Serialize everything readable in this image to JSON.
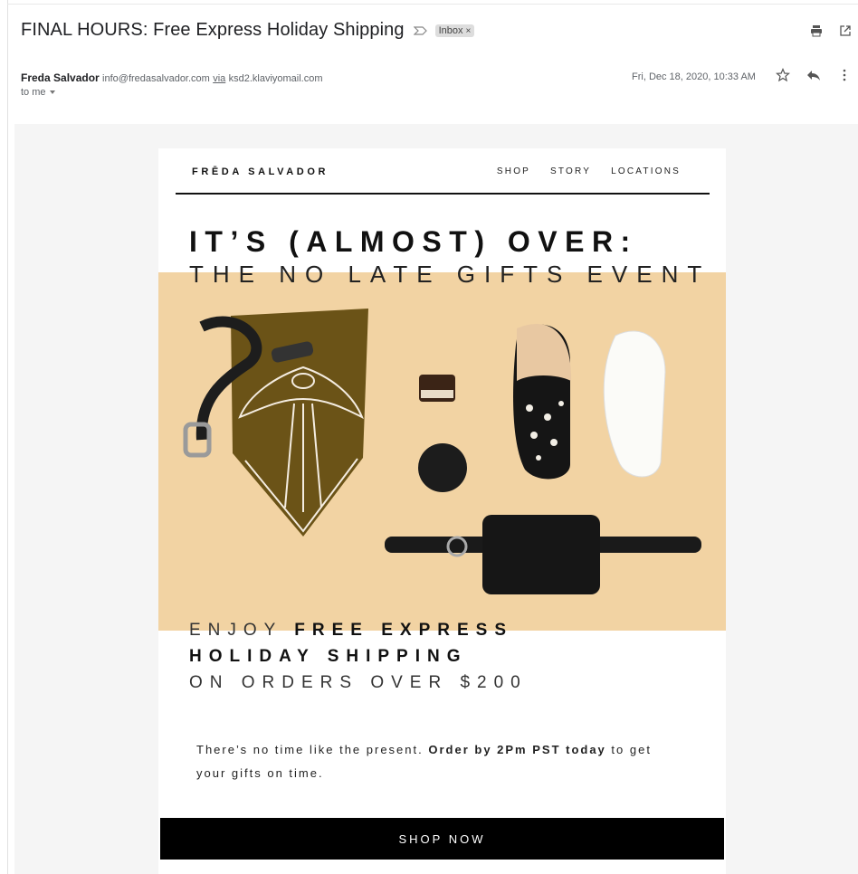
{
  "email": {
    "subject": "FINAL HOURS: Free Express Holiday Shipping",
    "label": "Inbox",
    "label_close": "×",
    "sender_name": "Freda Salvador",
    "sender_email": "info@fredasalvador.com",
    "via_text": "via",
    "via_domain": "ksd2.klaviyomail.com",
    "recipient": "to me",
    "date": "Fri, Dec 18, 2020, 10:33 AM"
  },
  "icons": {
    "importance": "importance-marker-icon",
    "print": "print-icon",
    "new_window": "open-in-new-window-icon",
    "star": "star-icon",
    "reply": "reply-icon",
    "more": "more-vertical-icon",
    "recipient_dropdown": "chevron-down-icon"
  },
  "newsletter": {
    "brand": "FRĒDA SALVADOR",
    "nav": [
      "SHOP",
      "STORY",
      "LOCATIONS"
    ],
    "headline_1": "IT’S (ALMOST) OVER:",
    "headline_2": "THE NO LATE GIFTS EVENT",
    "promo_light_1": "ENJOY ",
    "promo_bold_1": "FREE EXPRESS",
    "promo_bold_2": "HOLIDAY SHIPPING",
    "promo_light_2": "ON ORDERS OVER $200",
    "body_pre": "There’s no time like the present. ",
    "body_bold": "Order by 2Pm PST today",
    "body_post": " to get your gifts on time.",
    "cta": "SHOP NOW"
  },
  "colors": {
    "photo_background": "#f2d3a3",
    "cta_background": "#000000",
    "email_canvas": "#f5f5f5"
  }
}
